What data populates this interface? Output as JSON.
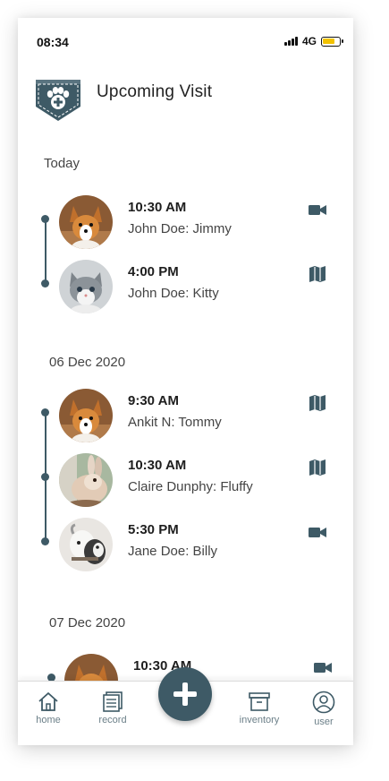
{
  "status_bar": {
    "time": "08:34",
    "network": "4G"
  },
  "header": {
    "title": "Upcoming Visit",
    "logo_icon": "paw-medical-pocket-icon"
  },
  "colors": {
    "accent": "#3e5a66",
    "battery": "#f2c200"
  },
  "sections": [
    {
      "label": "Today",
      "appointments": [
        {
          "time": "10:30 AM",
          "who": "John Doe: Jimmy",
          "pet": "corgi-puppy",
          "type": "video"
        },
        {
          "time": "4:00 PM",
          "who": "John Doe: Kitty",
          "pet": "kitten",
          "type": "map"
        }
      ]
    },
    {
      "label": "06 Dec 2020",
      "appointments": [
        {
          "time": "9:30 AM",
          "who": "Ankit N: Tommy",
          "pet": "corgi-puppy",
          "type": "map"
        },
        {
          "time": "10:30 AM",
          "who": "Claire Dunphy: Fluffy",
          "pet": "rabbit",
          "type": "map"
        },
        {
          "time": "5:30 PM",
          "who": "Jane Doe: Billy",
          "pet": "goat",
          "type": "video"
        }
      ]
    },
    {
      "label": "07 Dec 2020",
      "appointments": [
        {
          "time": "10:30 AM",
          "who": "",
          "pet": "corgi-puppy",
          "type": "video"
        }
      ]
    }
  ],
  "bottom_nav": {
    "home": "home",
    "record": "record",
    "inventory": "inventory",
    "user": "user",
    "add_icon": "plus-icon"
  }
}
